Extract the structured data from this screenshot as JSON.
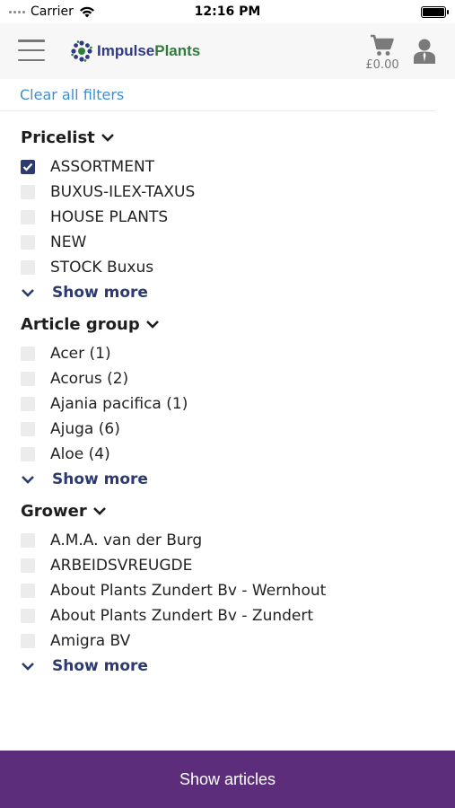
{
  "status": {
    "carrier": "Carrier",
    "time": "12:16 PM"
  },
  "header": {
    "logo_part1": "Impulse",
    "logo_part2": "Plants",
    "cart_price": "£0.00"
  },
  "filters": {
    "clear_label": "Clear all filters",
    "groups": [
      {
        "title": "Pricelist",
        "options": [
          {
            "label": "ASSORTMENT",
            "checked": true
          },
          {
            "label": "BUXUS-ILEX-TAXUS",
            "checked": false
          },
          {
            "label": "HOUSE PLANTS",
            "checked": false
          },
          {
            "label": "NEW",
            "checked": false
          },
          {
            "label": "STOCK Buxus",
            "checked": false
          }
        ],
        "show_more": "Show more"
      },
      {
        "title": "Article group",
        "options": [
          {
            "label": "Acer (1)",
            "checked": false
          },
          {
            "label": "Acorus (2)",
            "checked": false
          },
          {
            "label": "Ajania pacifica (1)",
            "checked": false
          },
          {
            "label": "Ajuga (6)",
            "checked": false
          },
          {
            "label": "Aloe (4)",
            "checked": false
          }
        ],
        "show_more": "Show more"
      },
      {
        "title": "Grower",
        "options": [
          {
            "label": "A.M.A. van der Burg",
            "checked": false
          },
          {
            "label": "ARBEIDSVREUGDE",
            "checked": false
          },
          {
            "label": "About Plants Zundert Bv - Wernhout",
            "checked": false
          },
          {
            "label": "About Plants Zundert Bv - Zundert",
            "checked": false
          },
          {
            "label": "Amigra BV",
            "checked": false
          }
        ],
        "show_more": "Show more"
      }
    ]
  },
  "footer": {
    "show_articles_label": "Show articles"
  },
  "colors": {
    "accent_purple": "#5c2d7a",
    "navy": "#2e3a6e",
    "link_blue": "#3b8ed8"
  }
}
